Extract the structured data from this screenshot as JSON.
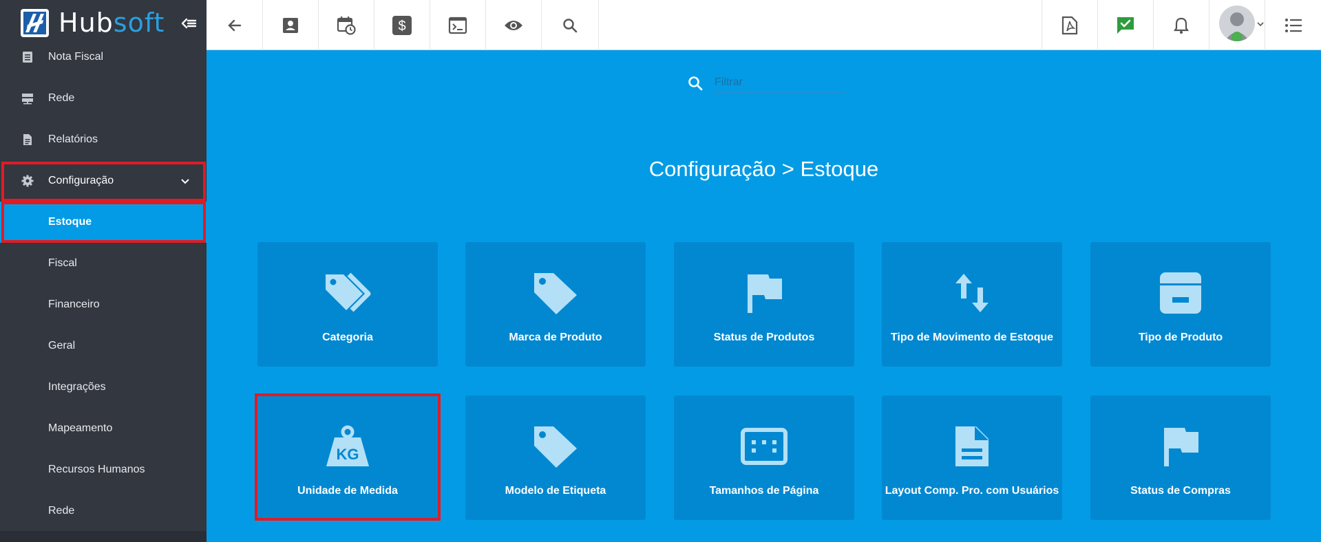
{
  "brand": {
    "name_part1": "Hub",
    "name_part2": "soft"
  },
  "sidebar": {
    "items": [
      {
        "label": "Nota Fiscal",
        "icon": "document-icon"
      },
      {
        "label": "Rede",
        "icon": "server-icon"
      },
      {
        "label": "Relatórios",
        "icon": "report-icon"
      },
      {
        "label": "Configuração",
        "icon": "gear-icon"
      },
      {
        "label": "Estoque"
      },
      {
        "label": "Fiscal"
      },
      {
        "label": "Financeiro"
      },
      {
        "label": "Geral"
      },
      {
        "label": "Integrações"
      },
      {
        "label": "Mapeamento"
      },
      {
        "label": "Recursos Humanos"
      },
      {
        "label": "Rede"
      }
    ]
  },
  "topbar": {
    "icons": [
      "back-arrow-icon",
      "contact-card-icon",
      "calendar-clock-icon",
      "dollar-icon",
      "terminal-icon",
      "eye-icon",
      "search-icon",
      "pdf-icon",
      "chat-check-icon",
      "bell-icon",
      "avatar",
      "list-menu-icon"
    ]
  },
  "search": {
    "placeholder": "Filtrar"
  },
  "main": {
    "title": "Configuração > Estoque",
    "cards": [
      {
        "label": "Categoria",
        "icon": "tags-icon"
      },
      {
        "label": "Marca de Produto",
        "icon": "tag-icon"
      },
      {
        "label": "Status de Produtos",
        "icon": "flag-icon"
      },
      {
        "label": "Tipo de Movimento de Estoque",
        "icon": "swap-vertical-icon"
      },
      {
        "label": "Tipo de Produto",
        "icon": "archive-box-icon"
      },
      {
        "label": "Unidade de Medida",
        "icon": "weight-kg-icon"
      },
      {
        "label": "Modelo de Etiqueta",
        "icon": "tag-icon"
      },
      {
        "label": "Tamanhos de Página",
        "icon": "page-size-icon"
      },
      {
        "label": "Layout Comp. Pro. com Usuários",
        "icon": "file-document-icon"
      },
      {
        "label": "Status de Compras",
        "icon": "flag-icon"
      }
    ],
    "card_icon_text_kg": "KG"
  },
  "colors": {
    "accent": "#039be5",
    "card": "#0288d1",
    "sidebar": "#323740",
    "highlight": "#e01b24",
    "icon_light": "#b3e0f7"
  }
}
